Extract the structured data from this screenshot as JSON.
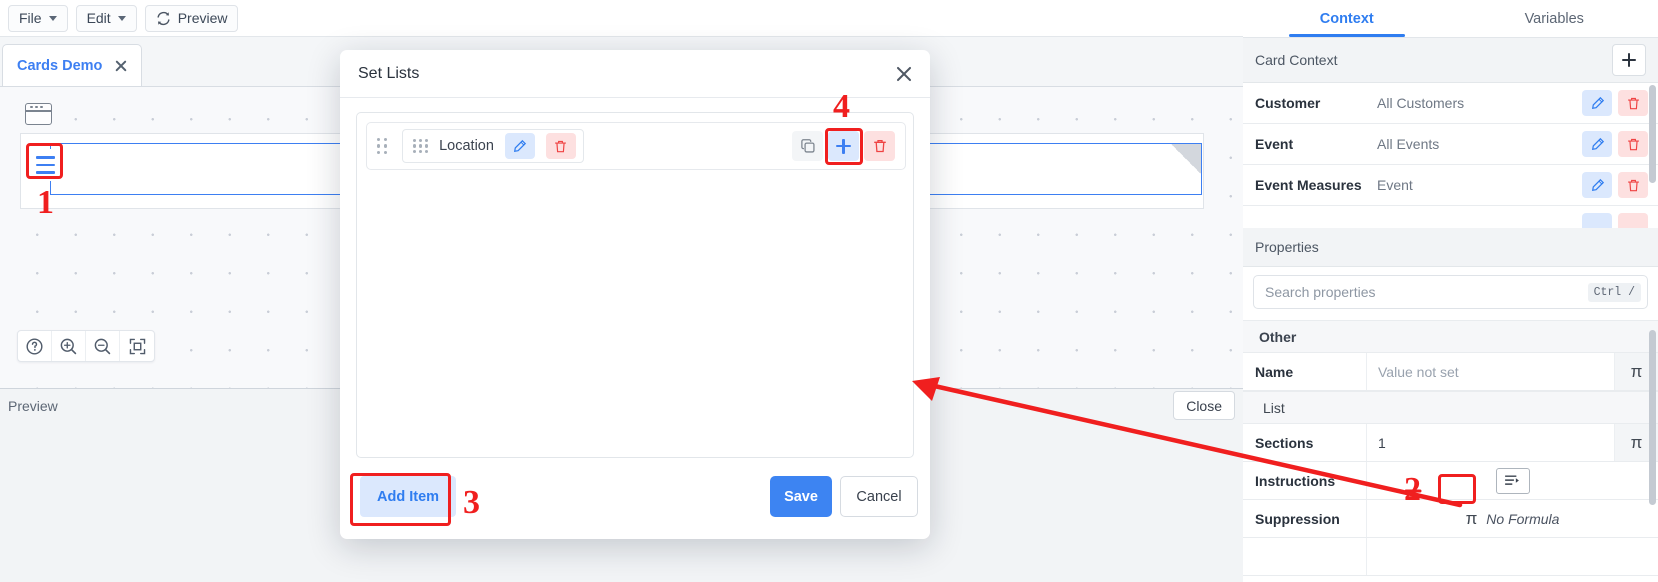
{
  "menubar": {
    "file": "File",
    "edit": "Edit",
    "preview": "Preview",
    "refresh_icon": "refresh-icon",
    "file_caret_icon": "chevron-down-icon",
    "edit_caret_icon": "chevron-down-icon"
  },
  "tabs": {
    "cards_demo": "Cards Demo",
    "close_icon": "close-icon"
  },
  "canvas": {
    "window_icon": "window-icon",
    "list_widget_icon": "list-lines-icon",
    "toolbar": {
      "help": "help-circle-icon",
      "zoom_in": "zoom-in-icon",
      "zoom_out": "zoom-out-icon",
      "fit": "fit-to-screen-icon"
    }
  },
  "preview_pane": {
    "label": "Preview",
    "close_label": "Close"
  },
  "right_panel": {
    "tabs": [
      {
        "label": "Context",
        "active": true
      },
      {
        "label": "Variables",
        "active": false
      }
    ],
    "card_context": {
      "title": "Card Context",
      "add_icon": "plus-icon",
      "rows": [
        {
          "name": "Customer",
          "value": "All Customers",
          "edit_icon": "pencil-icon",
          "delete_icon": "trash-icon"
        },
        {
          "name": "Event",
          "value": "All Events",
          "edit_icon": "pencil-icon",
          "delete_icon": "trash-icon"
        },
        {
          "name": "Event Measures",
          "value": "Event",
          "edit_icon": "pencil-icon",
          "delete_icon": "trash-icon"
        }
      ]
    },
    "properties": {
      "title": "Properties",
      "search_placeholder": "Search properties",
      "search_value": "",
      "search_shortcut": "Ctrl /",
      "groups": [
        {
          "label": "Other",
          "rows": [
            {
              "label": "Name",
              "value": "Value not set",
              "muted": true,
              "pi_icon": "pi-formula-icon"
            }
          ]
        },
        {
          "label": "List",
          "sub": true,
          "rows": [
            {
              "label": "Sections",
              "value": "1",
              "muted": false,
              "pi_icon": "pi-formula-icon"
            },
            {
              "label": "Instructions",
              "value": "",
              "muted": false,
              "button_icon": "list-edit-icon"
            },
            {
              "label": "Suppression",
              "value": "No Formula",
              "muted": false,
              "pi_inline": "π"
            }
          ]
        }
      ]
    }
  },
  "modal": {
    "title": "Set Lists",
    "close_icon": "close-icon",
    "item": {
      "drag_handle_outer_icon": "drag-handle-icon",
      "drag_handle_inner_icon": "drag-grid-icon",
      "name": "Location",
      "edit_icon": "pencil-icon",
      "delete_icon": "trash-icon",
      "copy_icon": "copy-icon",
      "add_icon": "plus-icon",
      "row_delete_icon": "trash-icon"
    },
    "add_item_label": "Add Item",
    "save_label": "Save",
    "cancel_label": "Cancel"
  },
  "annotations": {
    "accent_color": "#f01f1f",
    "markers": [
      {
        "id": "1",
        "target": "canvas-list-widget-icon"
      },
      {
        "id": "2",
        "target": "instructions-edit-button"
      },
      {
        "id": "3",
        "target": "add-item-button"
      },
      {
        "id": "4",
        "target": "item-add-button"
      }
    ]
  }
}
